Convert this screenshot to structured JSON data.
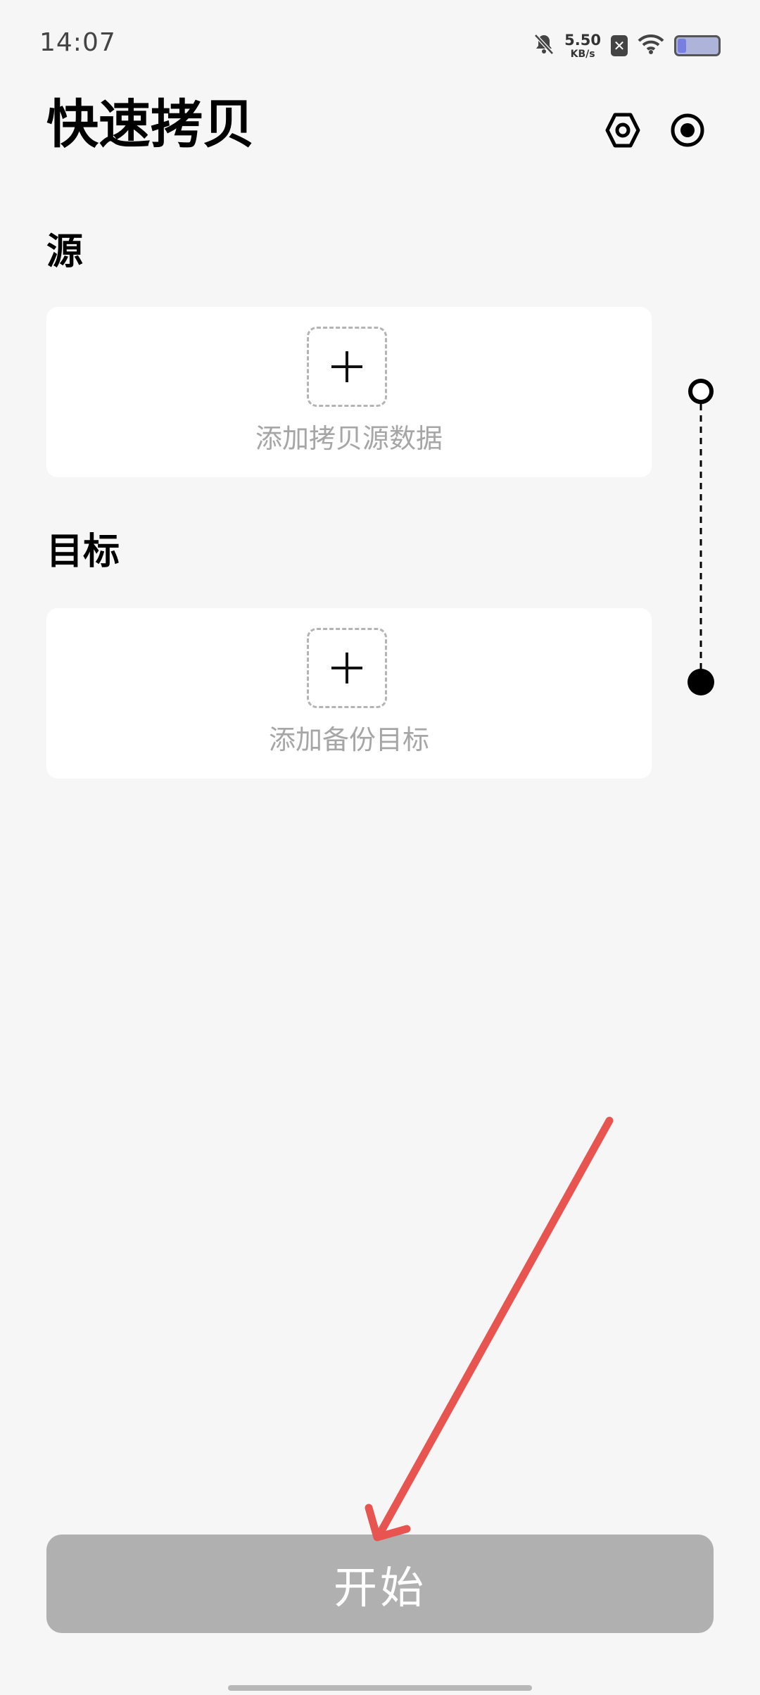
{
  "status_bar": {
    "time": "14:07",
    "net_speed_value": "5.50",
    "net_speed_unit": "KB/s",
    "icons": [
      "bell-muted-icon",
      "sim-error-icon",
      "wifi-icon",
      "battery-icon"
    ],
    "battery_level": 0.2
  },
  "header": {
    "title": "快速拷贝",
    "icons": [
      "settings-hexagon-icon",
      "record-icon"
    ]
  },
  "source": {
    "label": "源",
    "add_text": "添加拷贝源数据"
  },
  "target": {
    "label": "目标",
    "add_text": "添加备份目标"
  },
  "start_button": {
    "label": "开始"
  },
  "colors": {
    "background": "#f7f6f7",
    "card": "#ffffff",
    "button_disabled": "#b0b0b0",
    "placeholder_text": "#a6a6a6",
    "annotation_arrow": "#e8544f"
  }
}
